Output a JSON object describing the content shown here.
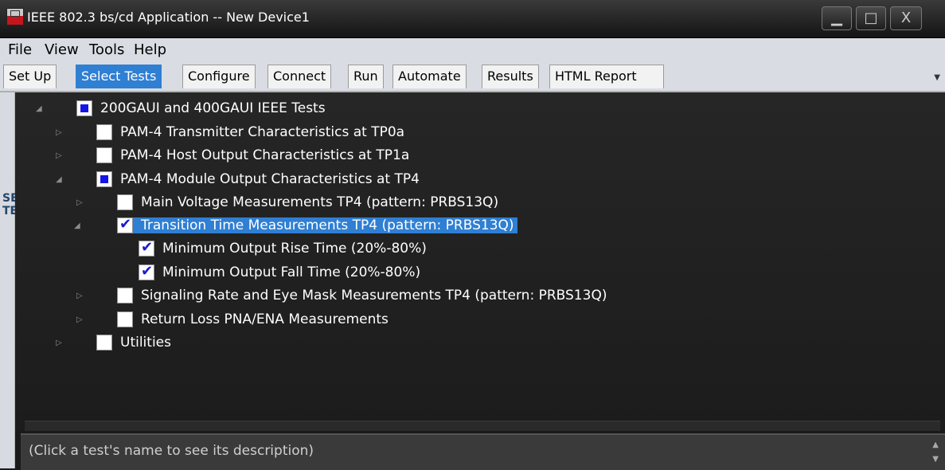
{
  "window": {
    "title": "IEEE 802.3 bs/cd Application -- New Device1",
    "minimize": "▁",
    "maximize": "□",
    "close": "X"
  },
  "menu": {
    "items": [
      "File",
      "View",
      "Tools",
      "Help"
    ]
  },
  "tabs": [
    {
      "label": "Set Up"
    },
    {
      "label": "Select Tests",
      "active": true
    },
    {
      "label": "Configure"
    },
    {
      "label": "Connect"
    },
    {
      "label": "Run"
    },
    {
      "label": "Automate"
    },
    {
      "label": "Results"
    },
    {
      "label": "HTML Report"
    }
  ],
  "side_strip": {
    "label": "SELECT TESTS"
  },
  "tree": [
    {
      "label": "200GAUI and 400GAUI IEEE Tests",
      "state": "partial",
      "expander": "expanded"
    },
    {
      "label": "PAM-4 Transmitter Characteristics at TP0a",
      "state": "unchecked",
      "expander": "collapsed"
    },
    {
      "label": "PAM-4 Host Output Characteristics at TP1a",
      "state": "unchecked",
      "expander": "collapsed"
    },
    {
      "label": "PAM-4 Module Output Characteristics at TP4",
      "state": "partial",
      "expander": "expanded"
    },
    {
      "label": "Main Voltage Measurements TP4 (pattern: PRBS13Q)",
      "state": "unchecked",
      "expander": "collapsed"
    },
    {
      "label": "Transition Time Measurements TP4 (pattern: PRBS13Q)",
      "state": "checked",
      "expander": "expanded",
      "selected": true
    },
    {
      "label": "Minimum Output Rise Time (20%-80%)",
      "state": "checked",
      "expander": "none"
    },
    {
      "label": "Minimum Output Fall Time (20%-80%)",
      "state": "checked",
      "expander": "none"
    },
    {
      "label": "Signaling Rate and Eye Mask Measurements TP4 (pattern: PRBS13Q)",
      "state": "unchecked",
      "expander": "collapsed"
    },
    {
      "label": "Return Loss PNA/ENA Measurements",
      "state": "unchecked",
      "expander": "collapsed"
    },
    {
      "label": "Utilities",
      "state": "unchecked",
      "expander": "collapsed"
    }
  ],
  "status": {
    "description_hint": "(Click a test's name to see its description)"
  },
  "colors": {
    "selection": "#2f7fd3",
    "check": "#1a1acc",
    "background": "#1e1e1e"
  },
  "icons": {
    "expanded": "expanded-triangle-icon",
    "collapsed": "collapsed-triangle-icon"
  }
}
